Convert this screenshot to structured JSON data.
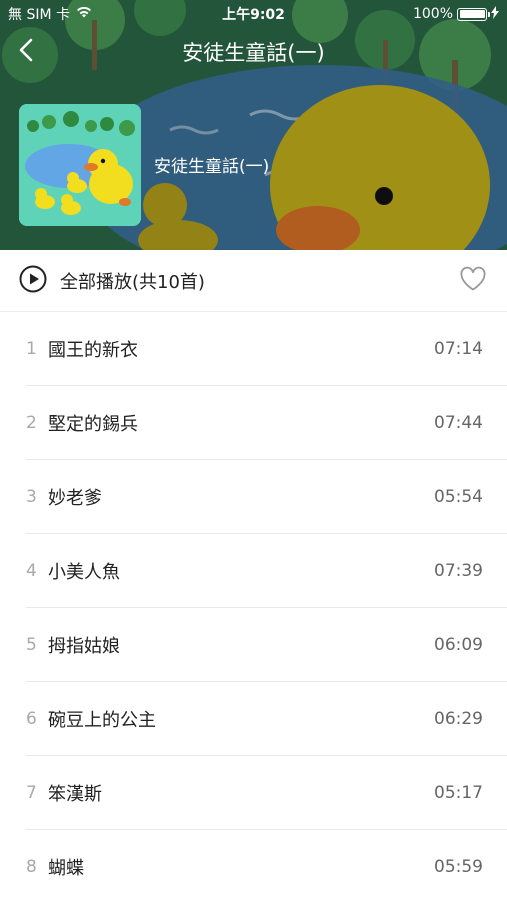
{
  "status_bar": {
    "carrier": "無 SIM 卡",
    "time": "上午9:02",
    "battery_percent": "100%",
    "battery_level": 1.0
  },
  "nav": {
    "back_icon": "chevron-left-icon",
    "title": "安徒生童話(一)"
  },
  "album": {
    "name": "安徒生童話(一)"
  },
  "play_all": {
    "label": "全部播放(共10首)",
    "play_icon": "play-circle-icon",
    "favorite_icon": "heart-outline-icon"
  },
  "tracks": [
    {
      "num": "1",
      "title": "國王的新衣",
      "duration": "07:14"
    },
    {
      "num": "2",
      "title": "堅定的錫兵",
      "duration": "07:44"
    },
    {
      "num": "3",
      "title": "妙老爹",
      "duration": "05:54"
    },
    {
      "num": "4",
      "title": "小美人魚",
      "duration": "07:39"
    },
    {
      "num": "5",
      "title": "拇指姑娘",
      "duration": "06:09"
    },
    {
      "num": "6",
      "title": "碗豆上的公主",
      "duration": "06:29"
    },
    {
      "num": "7",
      "title": "笨漢斯",
      "duration": "05:17"
    },
    {
      "num": "8",
      "title": "蝴蝶",
      "duration": "05:59"
    }
  ],
  "colors": {
    "hero_green": "#2e6e4e",
    "pond_blue": "#3c6ea3",
    "duck_yellow": "#e8d21a",
    "duck_beak": "#e0742a"
  }
}
